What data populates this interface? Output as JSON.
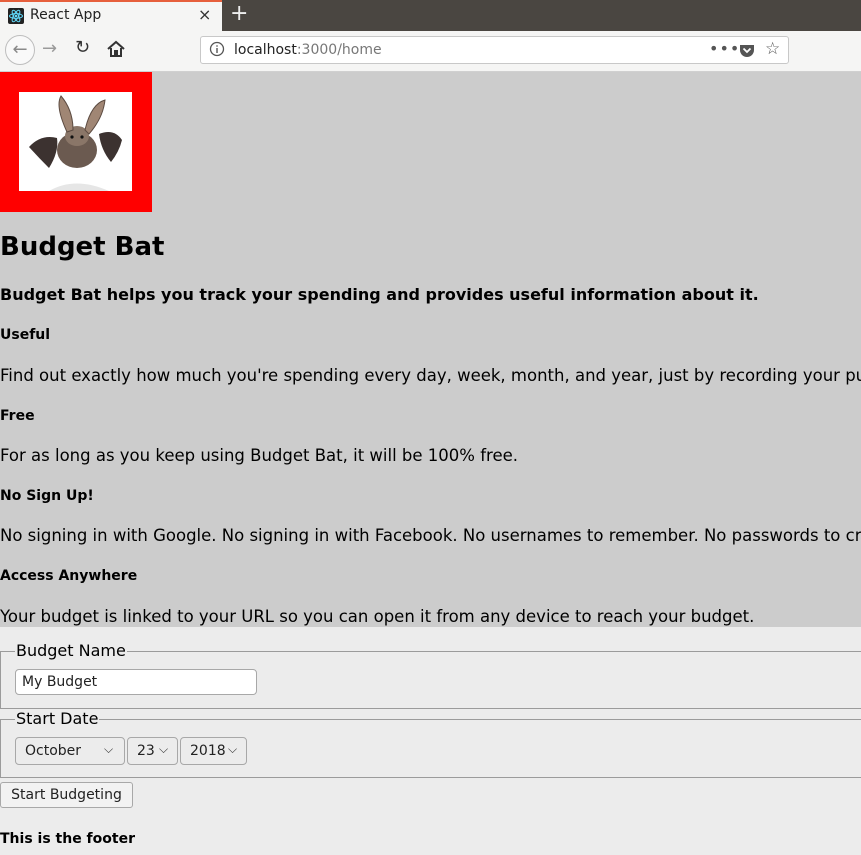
{
  "browser": {
    "tab_title": "React App",
    "tab_close": "×",
    "new_tab": "+",
    "url_host": "localhost",
    "url_rest": ":3000/home",
    "menu_dots": "•••",
    "star": "☆"
  },
  "nav": {
    "back": "←",
    "forward": "→",
    "reload": "↻"
  },
  "hero": {
    "title": "Budget Bat",
    "tagline": "Budget Bat helps you track your spending and provides useful information about it.",
    "features": [
      {
        "heading": "Useful",
        "text": "Find out exactly how much you're spending every day, week, month, and year, just by recording your purcha"
      },
      {
        "heading": "Free",
        "text": "For as long as you keep using Budget Bat, it will be 100% free."
      },
      {
        "heading": "No Sign Up!",
        "text": "No signing in with Google. No signing in with Facebook. No usernames to remember. No passwords to create"
      },
      {
        "heading": "Access Anywhere",
        "text": "Your budget is linked to your URL so you can open it from any device to reach your budget."
      }
    ]
  },
  "form": {
    "budget_name_legend": "Budget Name",
    "budget_name_value": "My Budget",
    "start_date_legend": "Start Date",
    "month": "October",
    "day": "23",
    "year": "2018",
    "submit_label": "Start Budgeting"
  },
  "footer": {
    "text": "This is the footer"
  },
  "colors": {
    "logo_bg": "#ff0000",
    "hero_bg": "#cccccc",
    "page_bg": "#ececec",
    "tab_accent": "#e65f3c"
  }
}
